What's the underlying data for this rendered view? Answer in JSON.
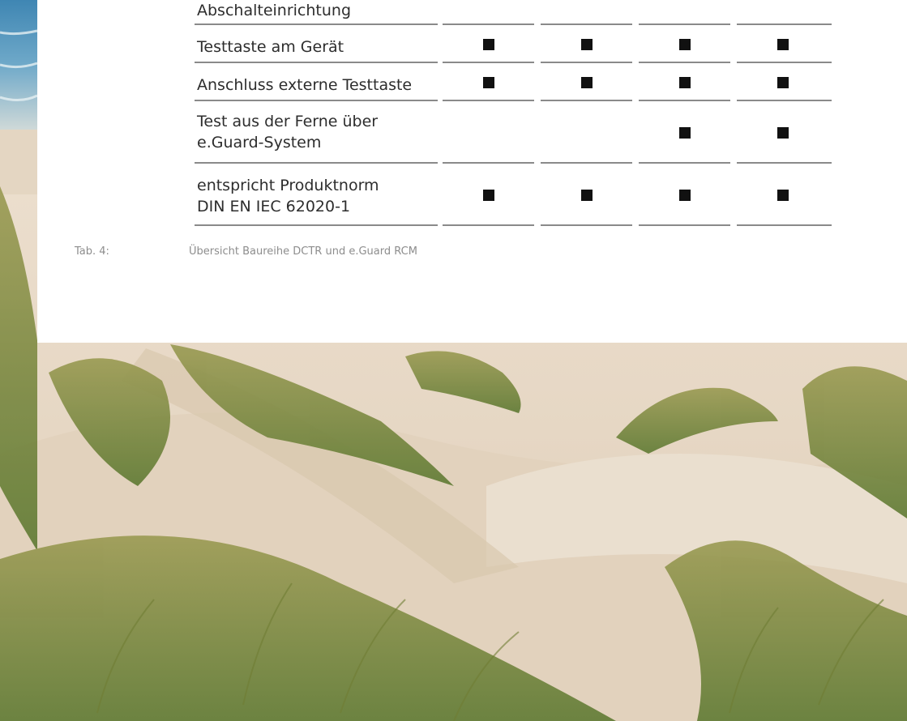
{
  "table": {
    "rows": [
      {
        "label_lines": [
          "Abschalteinrichtung"
        ],
        "marks": [
          false,
          false,
          false,
          false
        ]
      },
      {
        "label_lines": [
          "Testtaste am Gerät"
        ],
        "marks": [
          true,
          true,
          true,
          true
        ]
      },
      {
        "label_lines": [
          "Anschluss externe Testtaste"
        ],
        "marks": [
          true,
          true,
          true,
          true
        ]
      },
      {
        "label_lines": [
          "Test aus der Ferne über",
          "e.Guard-System"
        ],
        "marks": [
          false,
          false,
          true,
          true
        ]
      },
      {
        "label_lines": [
          "entspricht Produktnorm",
          "DIN EN IEC 62020-1"
        ],
        "marks": [
          true,
          true,
          true,
          true
        ]
      }
    ]
  },
  "caption": {
    "tag": "Tab. 4:",
    "text": "Übersicht Baureihe DCTR und e.Guard RCM"
  },
  "colors": {
    "text": "#2d2d2d",
    "rule": "#8a8a8a",
    "mark": "#111111",
    "caption": "#8d8d8d",
    "sand": "#e9dccb",
    "grass": "#7d8a3c"
  },
  "background_image": {
    "subject": "sand-dunes-with-beach-grass-and-sea",
    "icon": "photo-icon"
  }
}
